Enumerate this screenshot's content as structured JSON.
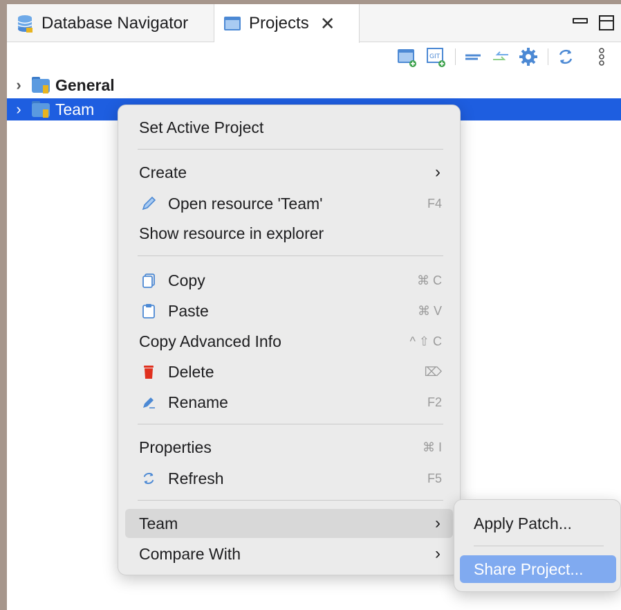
{
  "tabs": {
    "database_navigator": "Database Navigator",
    "projects": "Projects",
    "close_glyph": "✕"
  },
  "toolbar": {
    "icons": [
      "new-project-icon",
      "git-clone-icon",
      "collapse-all-icon",
      "link-editor-icon",
      "settings-icon",
      "refresh-icon",
      "view-menu-icon"
    ]
  },
  "tree": {
    "items": [
      {
        "label": "General",
        "expanded": false,
        "selected": false
      },
      {
        "label": "Team",
        "expanded": false,
        "selected": true
      }
    ]
  },
  "context_menu": {
    "set_active_project": "Set Active Project",
    "create": "Create",
    "open_resource": "Open resource 'Team'",
    "open_resource_shortcut": "F4",
    "show_in_explorer": "Show resource in explorer",
    "copy": "Copy",
    "copy_shortcut": "⌘ C",
    "paste": "Paste",
    "paste_shortcut": "⌘ V",
    "copy_advanced": "Copy Advanced Info",
    "copy_advanced_shortcut": "^ ⇧ C",
    "delete": "Delete",
    "delete_shortcut": "⌦",
    "rename": "Rename",
    "rename_shortcut": "F2",
    "properties": "Properties",
    "properties_shortcut": "⌘ I",
    "refresh": "Refresh",
    "refresh_shortcut": "F5",
    "team": "Team",
    "compare_with": "Compare With",
    "submenu_arrow": "›"
  },
  "team_submenu": {
    "apply_patch": "Apply Patch...",
    "share_project": "Share Project..."
  },
  "colors": {
    "selection": "#1e5ee0",
    "submenu_selection": "#80aaf0",
    "menu_bg": "#ebebeb",
    "delete_red": "#e0301e"
  }
}
